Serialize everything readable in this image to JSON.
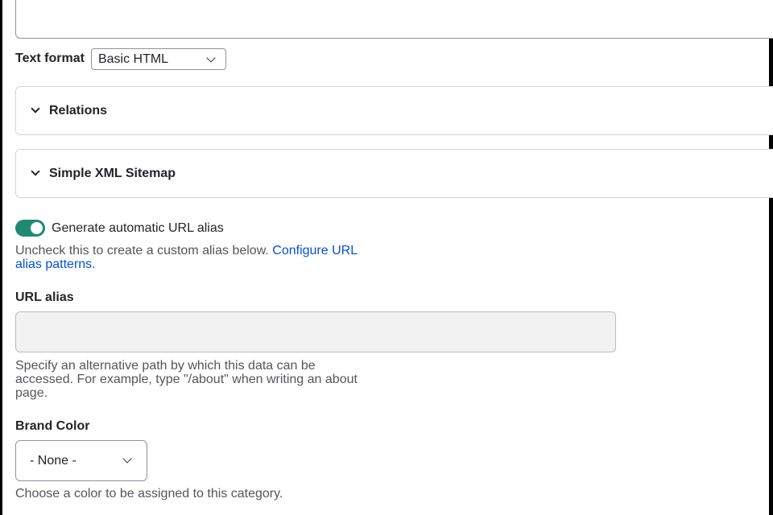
{
  "text_format": {
    "label": "Text format",
    "selected": "Basic HTML"
  },
  "sections": {
    "relations": "Relations",
    "sitemap": "Simple XML Sitemap"
  },
  "url_alias": {
    "toggle_label": "Generate automatic URL alias",
    "toggle_checked": true,
    "help_text": "Uncheck this to create a custom alias below.",
    "help_link_line1": "Configure URL",
    "help_link_line2": "alias patterns.",
    "field_label": "URL alias",
    "value": "",
    "desc_line1": "Specify an alternative path by which this data can be",
    "desc_line2": "accessed. For example, type \"/about\" when writing an about",
    "desc_line3": "page."
  },
  "brand_color": {
    "label": "Brand Color",
    "selected": "- None -",
    "description": "Choose a color to be assigned to this category."
  },
  "colors": {
    "toggle_on": "#1e8a73",
    "link": "#0550d8"
  },
  "icons": {
    "select_arrow": "chevron-down-icon",
    "details_arrow": "chevron-down-icon"
  }
}
